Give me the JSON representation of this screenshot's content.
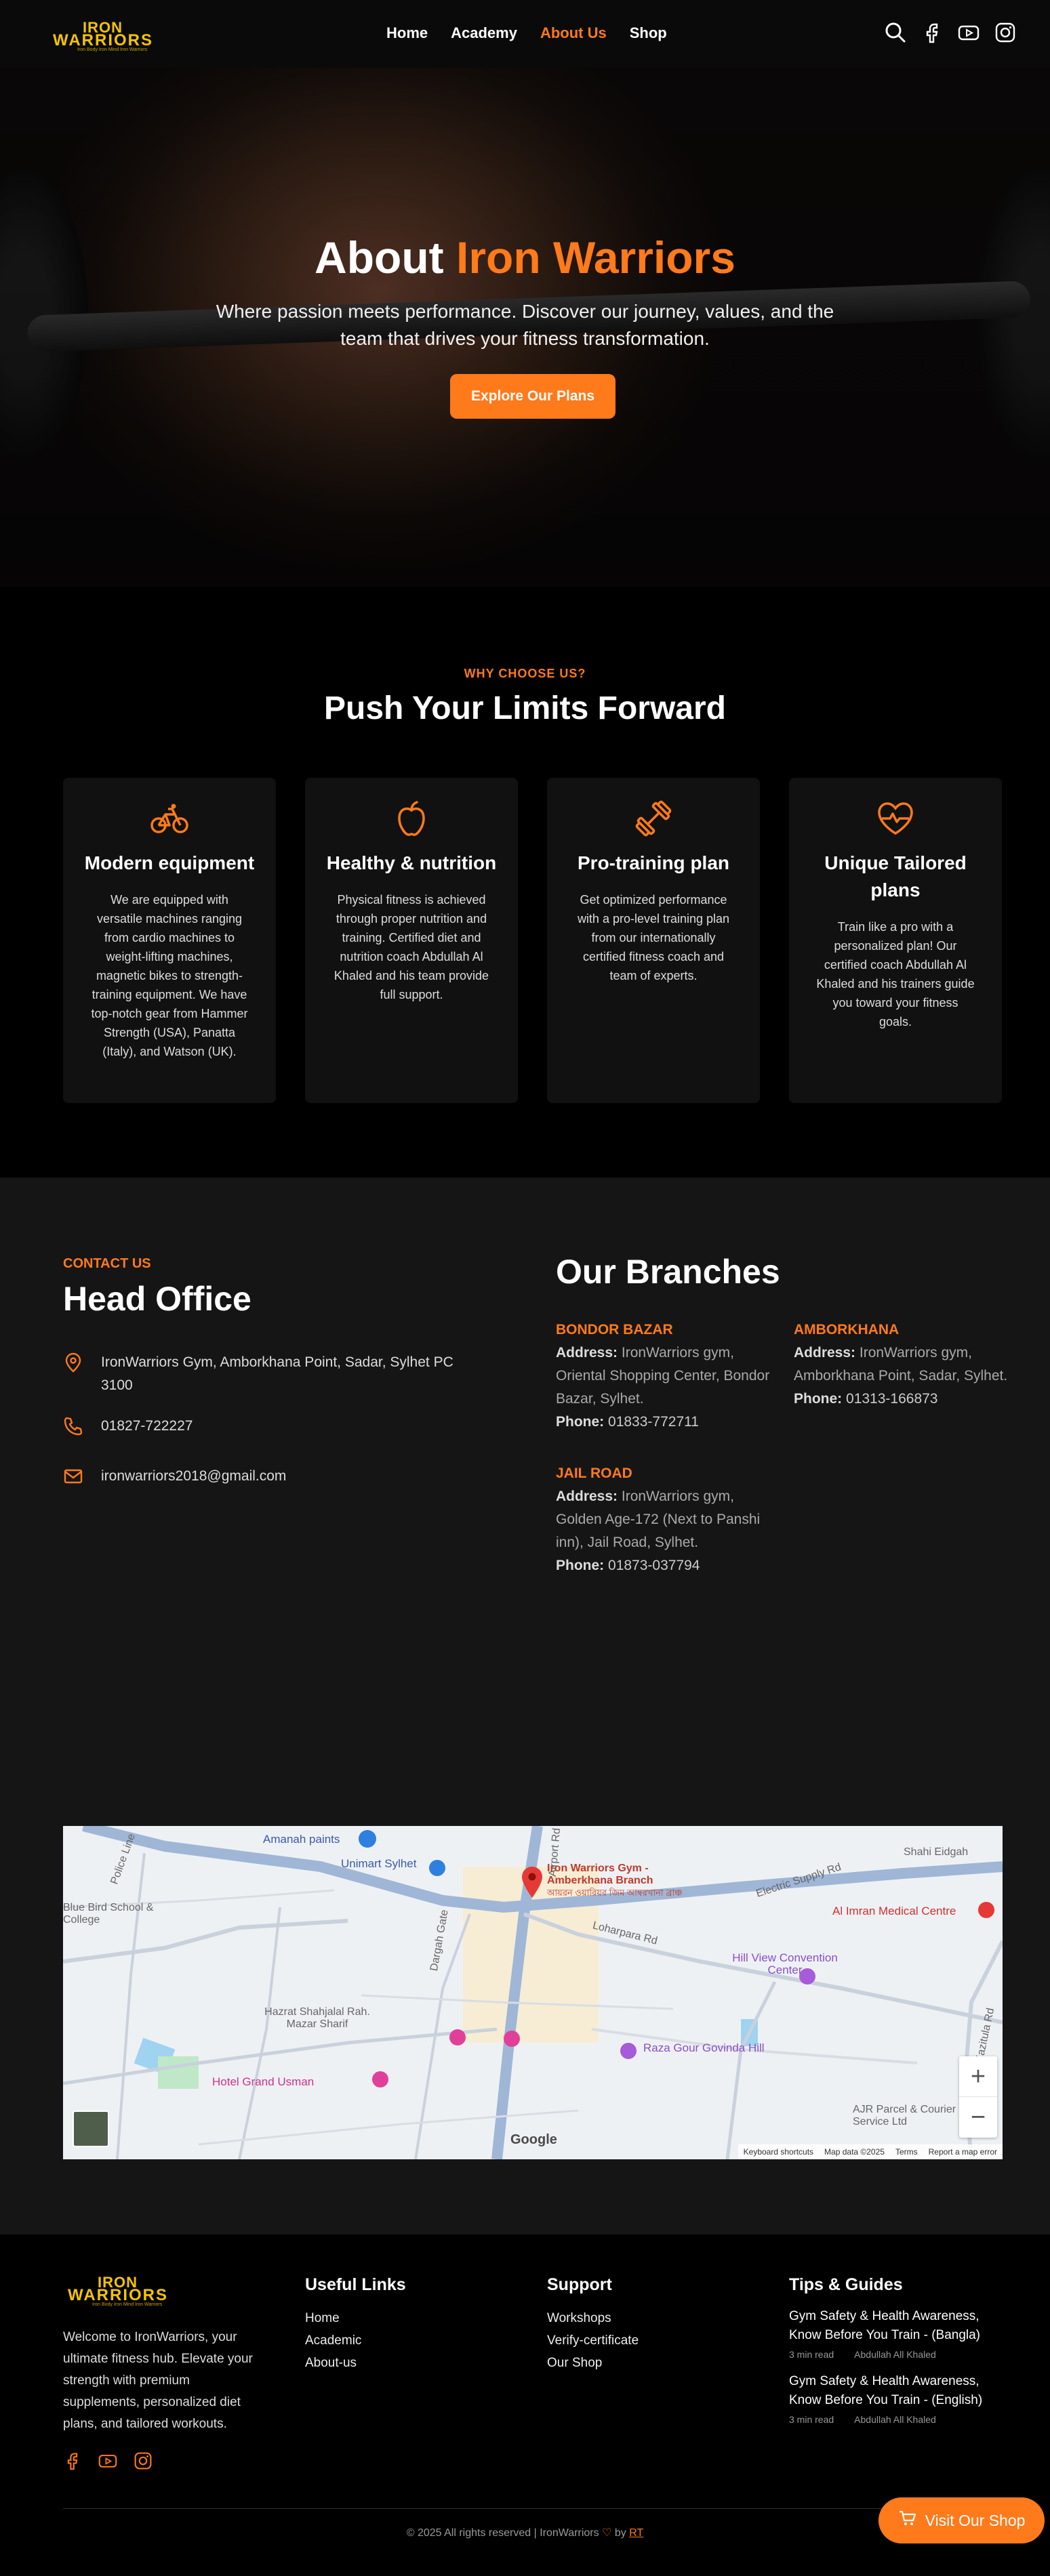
{
  "brand": {
    "logo_top": "IRON",
    "logo_bottom": "WARRIORS",
    "logo_tag": "Iron Body Iron Mind Iron Warriors"
  },
  "nav": {
    "items": [
      {
        "label": "Home",
        "active": false
      },
      {
        "label": "Academy",
        "active": false
      },
      {
        "label": "About Us",
        "active": true
      },
      {
        "label": "Shop",
        "active": false
      }
    ],
    "icons": [
      "search-icon",
      "facebook-icon",
      "youtube-icon",
      "instagram-icon"
    ]
  },
  "hero": {
    "title_a": "About ",
    "title_b": "Iron Warriors",
    "subtitle": "Where passion meets performance. Discover our journey, values, and the team that drives your fitness transformation.",
    "cta": "Explore Our Plans"
  },
  "why": {
    "kicker": "WHY CHOOSE US?",
    "title": "Push Your Limits Forward",
    "cards": [
      {
        "icon": "bicycle-icon",
        "title": "Modern equipment",
        "text": "We are equipped with versatile machines ranging from cardio machines to weight-lifting machines, magnetic bikes to strength-training equipment. We have top-notch gear from Hammer Strength (USA), Panatta (Italy), and Watson (UK)."
      },
      {
        "icon": "apple-icon",
        "title": "Healthy & nutrition",
        "text": "Physical fitness is achieved through proper nutrition and training. Certified diet and nutrition coach Abdullah Al Khaled and his team provide full support."
      },
      {
        "icon": "dumbbell-icon",
        "title": "Pro-training plan",
        "text": "Get optimized performance with a pro-level training plan from our internationally certified fitness coach and team of experts."
      },
      {
        "icon": "heart-pulse-icon",
        "title": "Unique Tailored plans",
        "text": "Train like a pro with a personalized plan! Our certified coach Abdullah Al Khaled and his trainers guide you toward your fitness goals."
      }
    ]
  },
  "contact": {
    "kicker": "CONTACT US",
    "title": "Head Office",
    "address": "IronWarriors Gym, Amborkhana Point, Sadar, Sylhet PC 3100",
    "phone": "01827-722227",
    "email": "ironwarriors2018@gmail.com"
  },
  "branches": {
    "title": "Our Branches",
    "address_label": "Address:",
    "phone_label": "Phone:",
    "list": [
      {
        "name": "BONDOR BAZAR",
        "address": "IronWarriors gym, Oriental Shopping Center, Bondor Bazar, Sylhet.",
        "phone": "01833-772711"
      },
      {
        "name": "AMBORKHANA",
        "address": "IronWarriors gym, Amborkhana Point, Sadar, Sylhet.",
        "phone": "01313-166873"
      },
      {
        "name": "JAIL ROAD",
        "address": "IronWarriors gym, Golden Age-172 (Next to Panshi inn), Jail Road, Sylhet.",
        "phone": "01873-037794"
      }
    ]
  },
  "map": {
    "pin_label": "Iron Warriors Gym - Amberkhana Branch",
    "pin_label_bn": "আয়রন ওয়ারিয়র জিম আম্বরখানা ব্রাঞ্চ",
    "places": [
      "Amanah paints",
      "Unimart Sylhet",
      "Shahi Eidgah",
      "Blue Bird School & College",
      "Electric Supply Rd",
      "Al Imran Medical Centre",
      "Loharpara Rd",
      "Hill View Convention Center",
      "Hazrat Shahjalal Rah. Mazar Sharif",
      "Raza Gour Govinda Hill",
      "Hotel Grand Usman",
      "AJR Parcel & Courier Service Ltd",
      "Police Line",
      "Dargah Gate",
      "Kazitula Rd",
      "Airport Rd"
    ],
    "footer": [
      "Keyboard shortcuts",
      "Map data ©2025",
      "Terms",
      "Report a map error"
    ],
    "google": "Google",
    "zoom_in": "+",
    "zoom_out": "−"
  },
  "footer": {
    "desc": "Welcome to IronWarriors, your ultimate fitness hub. Elevate your strength with premium supplements, personalized diet plans, and tailored workouts.",
    "useful_title": "Useful Links",
    "useful": [
      "Home",
      "Academic",
      "About-us"
    ],
    "support_title": "Support",
    "support": [
      "Workshops",
      "Verify-certificate",
      "Our Shop"
    ],
    "tips_title": "Tips & Guides",
    "tips": [
      {
        "title": "Gym Safety & Health Awareness, Know Before You Train - (Bangla)",
        "read": "3 min read",
        "author": "Abdullah All Khaled"
      },
      {
        "title": "Gym Safety & Health Awareness, Know Before You Train - (English)",
        "read": "3 min read",
        "author": "Abdullah All Khaled"
      }
    ],
    "copyright_a": "© 2025 All rights reserved | IronWarriors ",
    "copyright_b": " by ",
    "copyright_link": "RT"
  },
  "shop_button": "Visit Our Shop",
  "colors": {
    "accent": "#ff7a1a",
    "logo": "#f5c400",
    "bg": "#000000",
    "section": "#151515",
    "card": "#111111"
  }
}
